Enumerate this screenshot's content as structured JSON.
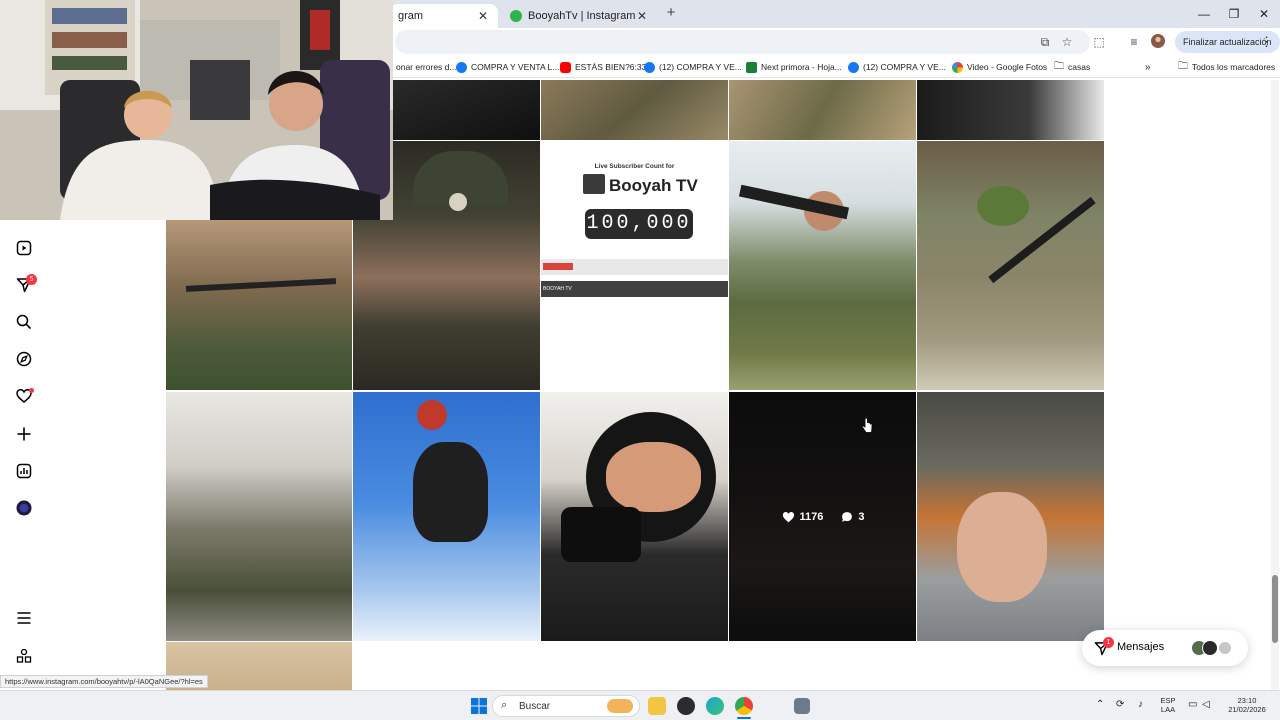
{
  "browser": {
    "tabs": [
      {
        "title": "gram",
        "favicon": "instagram-icon"
      },
      {
        "title": "BooyahTv | Instagram, Facebook",
        "favicon": "booyah-icon"
      }
    ],
    "update_button": "Finalizar actualización",
    "bookmarks": [
      {
        "label": "onar errores d...",
        "icon": "none"
      },
      {
        "label": "COMPRA Y VENTA L...",
        "icon": "facebook-icon",
        "color": "#1877f2"
      },
      {
        "label": "ESTÁS BIEN?6:33",
        "icon": "youtube-icon",
        "color": "#ff0000"
      },
      {
        "label": "(12) COMPRA Y VE...",
        "icon": "facebook-icon",
        "color": "#1877f2"
      },
      {
        "label": "Next primora - Hoja...",
        "icon": "sheets-icon",
        "color": "#188038"
      },
      {
        "label": "(12) COMPRA Y VE...",
        "icon": "facebook-icon",
        "color": "#1877f2"
      },
      {
        "label": "Video - Google Fotos",
        "icon": "photos-icon",
        "color": "#fbbc04"
      },
      {
        "label": "casas",
        "icon": "folder-icon",
        "color": "#555"
      },
      {
        "label": "Todos los marcadores",
        "icon": "folder-icon",
        "color": "#555"
      }
    ],
    "status_url": "https://www.instagram.com/booyahtv/p/-lA0QaNGee/?hl=es"
  },
  "grid": {
    "subscriber_card": {
      "heading": "Live Subscriber Count for",
      "channel": "Booyah TV",
      "count": "100,000",
      "footer_label": "BOOYAH TV"
    },
    "hover_overlay": {
      "likes": "1176",
      "comments": "3"
    }
  },
  "messages": {
    "label": "Mensajes",
    "badge": "1"
  },
  "rail": {
    "notification_badge": "5"
  },
  "taskbar": {
    "search_placeholder": "Buscar",
    "lang_line1": "ESP",
    "lang_line2": "LAA",
    "time": "23:10",
    "date": "21/02/2026"
  },
  "colors": {
    "accent_red": "#ff3040",
    "instagram_text": "#000000",
    "chrome_tabstrip": "#dfe3eb",
    "update_button": "#dbe5f8"
  }
}
